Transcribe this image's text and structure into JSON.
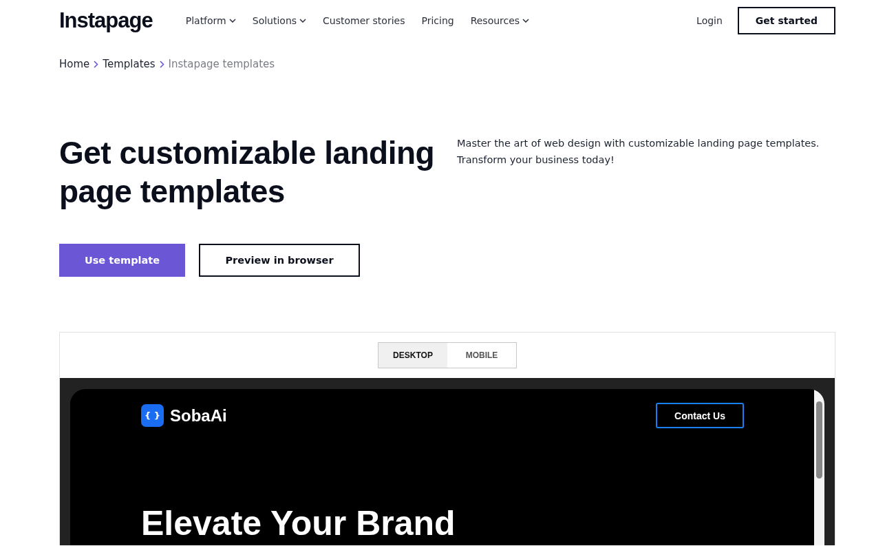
{
  "header": {
    "logo": "Instapage",
    "nav": [
      {
        "label": "Platform",
        "has_menu": true
      },
      {
        "label": "Solutions",
        "has_menu": true
      },
      {
        "label": "Customer stories",
        "has_menu": false
      },
      {
        "label": "Pricing",
        "has_menu": false
      },
      {
        "label": "Resources",
        "has_menu": true
      }
    ],
    "login": "Login",
    "cta": "Get started"
  },
  "breadcrumb": [
    {
      "label": "Home",
      "current": false
    },
    {
      "label": "Templates",
      "current": false
    },
    {
      "label": "Instapage templates",
      "current": true
    }
  ],
  "hero": {
    "title": "Get customizable landing page templates",
    "description": "Master the art of web design with customizable landing page templates. Transform your business today!",
    "primary_button": "Use template",
    "secondary_button": "Preview in browser"
  },
  "preview": {
    "tabs": [
      {
        "label": "DESKTOP",
        "selected": true
      },
      {
        "label": "MOBILE",
        "selected": false
      }
    ],
    "site": {
      "logo_mark": "{ }",
      "logo": "SobaAi",
      "contact_button": "Contact Us",
      "headline": "Elevate Your Brand"
    }
  }
}
